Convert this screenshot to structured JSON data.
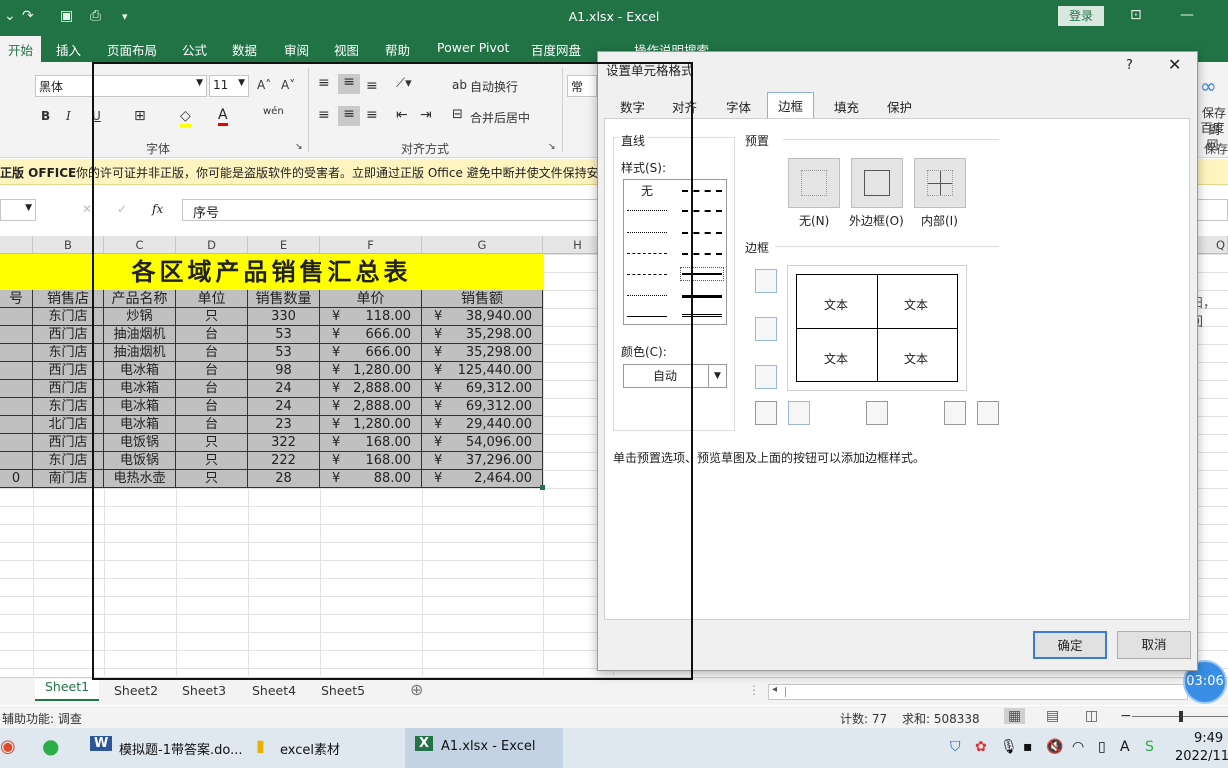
{
  "app": {
    "title": "A1.xlsx  -  Excel",
    "login": "登录"
  },
  "menu": [
    "开始",
    "插入",
    "页面布局",
    "公式",
    "数据",
    "审阅",
    "视图",
    "帮助",
    "Power Pivot",
    "百度网盘"
  ],
  "tell_me": "操作说明搜索",
  "ribbon": {
    "font_name": "黑体",
    "font_size": "11",
    "font_group": "字体",
    "align_group": "对齐方式",
    "wrap_text": "自动换行",
    "merge_center": "合并后居中",
    "number_format": "常规",
    "save_label": "保存到",
    "save_label2": "百度网",
    "save_group": "保存"
  },
  "warning": {
    "title": "正版 OFFICE",
    "text": "你的许可证并非正版，你可能是盗版软件的受害者。立即通过正版 Office 避免中断并使文件保持安全"
  },
  "formula": {
    "fx": "fx",
    "value": "序号"
  },
  "columns": [
    "B",
    "C",
    "D",
    "E",
    "F",
    "G",
    "H",
    "Q"
  ],
  "sheet": {
    "title": "各区域产品销售汇总表",
    "headers": [
      "号",
      "销售店",
      "产品名称",
      "单位",
      "销售数量",
      "单价",
      "销售额"
    ],
    "rows": [
      [
        "",
        "东门店",
        "炒锅",
        "只",
        "330",
        "¥",
        "118.00",
        "¥",
        "38,940.00"
      ],
      [
        "",
        "西门店",
        "抽油烟机",
        "台",
        "53",
        "¥",
        "666.00",
        "¥",
        "35,298.00"
      ],
      [
        "",
        "东门店",
        "抽油烟机",
        "台",
        "53",
        "¥",
        "666.00",
        "¥",
        "35,298.00"
      ],
      [
        "",
        "西门店",
        "电冰箱",
        "台",
        "98",
        "¥",
        "1,280.00",
        "¥",
        "125,440.00"
      ],
      [
        "",
        "西门店",
        "电冰箱",
        "台",
        "24",
        "¥",
        "2,888.00",
        "¥",
        "69,312.00"
      ],
      [
        "",
        "东门店",
        "电冰箱",
        "台",
        "24",
        "¥",
        "2,888.00",
        "¥",
        "69,312.00"
      ],
      [
        "",
        "北门店",
        "电冰箱",
        "台",
        "23",
        "¥",
        "1,280.00",
        "¥",
        "29,440.00"
      ],
      [
        "",
        "西门店",
        "电饭锅",
        "只",
        "322",
        "¥",
        "168.00",
        "¥",
        "54,096.00"
      ],
      [
        "",
        "东门店",
        "电饭锅",
        "只",
        "222",
        "¥",
        "168.00",
        "¥",
        "37,296.00"
      ],
      [
        "0",
        "南门店",
        "电热水壶",
        "只",
        "28",
        "¥",
        "88.00",
        "¥",
        "2,464.00"
      ]
    ],
    "right_text": "扫，回"
  },
  "sheet_tabs": [
    "Sheet1",
    "Sheet2",
    "Sheet3",
    "Sheet4",
    "Sheet5"
  ],
  "status": {
    "left": "辅助功能: 调查",
    "count": "计数: 77",
    "sum": "求和: 508338"
  },
  "timer": "03:06",
  "taskbar": {
    "items": [
      "模拟题-1带答案.do...",
      "excel素材",
      "A1.xlsx - Excel"
    ],
    "time": "9:49",
    "date": "2022/11/"
  },
  "dialog": {
    "title": "设置单元格格式",
    "help": "?",
    "tabs": [
      "数字",
      "对齐",
      "字体",
      "边框",
      "填充",
      "保护"
    ],
    "line_group": "直线",
    "style_label": "样式(S):",
    "none_style": "无",
    "color_label": "颜色(C):",
    "color_value": "自动",
    "presets_label": "预置",
    "presets": [
      "无(N)",
      "外边框(O)",
      "内部(I)"
    ],
    "border_label": "边框",
    "preview_text": [
      "文本",
      "文本",
      "文本",
      "文本"
    ],
    "hint": "单击预置选项、预览草图及上面的按钮可以添加边框样式。",
    "ok": "确定",
    "cancel": "取消"
  }
}
